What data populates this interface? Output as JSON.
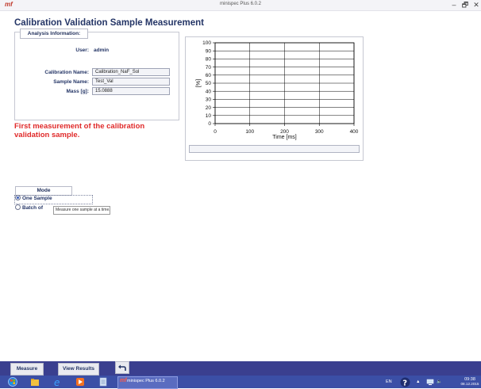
{
  "window": {
    "logo": "mf",
    "title": "minispec Plus 6.0.2",
    "minimize": "–",
    "maximize": "🗗",
    "close": "✕"
  },
  "page_title": "Calibration Validation Sample Measurement",
  "analysis": {
    "group_label": "Analysis Information:",
    "user_label": "User:",
    "user_value": "admin",
    "calibration_label": "Calibration Name:",
    "calibration_value": "Calibration_NaF_Sol",
    "sample_label": "Sample Name:",
    "sample_value": "Test_Val",
    "mass_label": "Mass [g]:",
    "mass_value": "15.0888"
  },
  "status_message": "First measurement of the calibration validation sample.",
  "chart_data": {
    "type": "line",
    "series": [],
    "xlabel": "Time [ms]",
    "ylabel": "[%]",
    "xlim": [
      0,
      400
    ],
    "ylim": [
      0,
      100
    ],
    "xticks": [
      "0",
      "100",
      "200",
      "300",
      "400"
    ],
    "yticks": [
      "0",
      "10",
      "20",
      "30",
      "40",
      "50",
      "60",
      "70",
      "80",
      "90",
      "100"
    ],
    "grid": true,
    "progress": 0
  },
  "mode": {
    "group_label": "Mode",
    "option_one": "One Sample",
    "option_batch": "Batch of",
    "tooltip": "Measure one sample at a time."
  },
  "actions": {
    "measure": "Measure",
    "view_results": "View Results",
    "undo_icon": "undo-arrow-icon"
  },
  "taskbar": {
    "app_label": "minispec Plus 6.0.2",
    "language": "EN",
    "time": "09:38",
    "date": "08.12.2015"
  },
  "colors": {
    "title": "#243566",
    "status": "#e02a2a",
    "action_bar": "#3a3f8f",
    "taskbar": "#3b4fa6"
  }
}
